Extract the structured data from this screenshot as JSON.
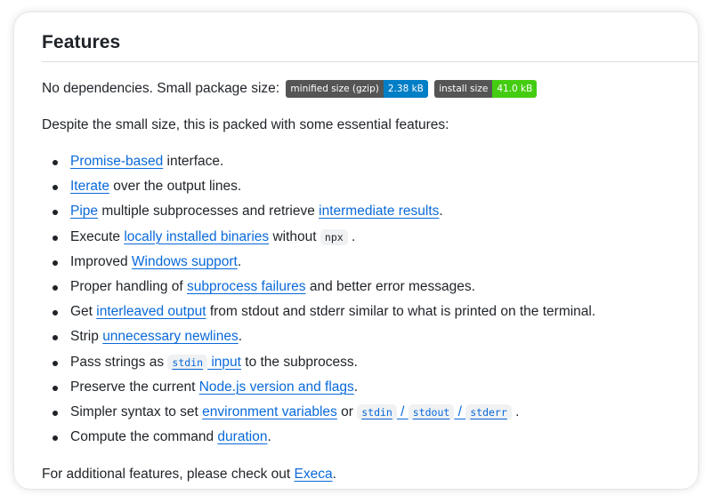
{
  "heading": "Features",
  "intro": {
    "text": "No dependencies. Small package size:",
    "badges": [
      {
        "label": "minified size (gzip)",
        "value": "2.38 kB",
        "color": "#007ec6"
      },
      {
        "label": "install size",
        "value": "41.0 kB",
        "color": "#44cc11"
      }
    ]
  },
  "lead": "Despite the small size, this is packed with some essential features:",
  "features": [
    {
      "a1": "Promise-based",
      "t1": " interface."
    },
    {
      "a1": "Iterate",
      "t1": " over the output lines."
    },
    {
      "a1": "Pipe",
      "t1": " multiple subprocesses and retrieve ",
      "a2": "intermediate results",
      "t2": "."
    },
    {
      "t0": "Execute ",
      "a1": "locally installed binaries",
      "t1": " without ",
      "code": "npx",
      "t2": "."
    },
    {
      "t0": "Improved ",
      "a1": "Windows support",
      "t1": "."
    },
    {
      "t0": "Proper handling of ",
      "a1": "subprocess failures",
      "t1": " and better error messages."
    },
    {
      "t0": "Get ",
      "a1": "interleaved output",
      "t1": " from stdout and stderr similar to what is printed on the terminal."
    },
    {
      "t0": "Strip ",
      "a1": "unnecessary newlines",
      "t1": "."
    },
    {
      "t0": "Pass strings as ",
      "code": "stdin",
      "a1": " input",
      "t1": " to the subprocess."
    },
    {
      "t0": "Preserve the current ",
      "a1": "Node.js version and flags",
      "t1": "."
    },
    {
      "t0": "Simpler syntax to set ",
      "a1": "environment variables",
      "t1": " or ",
      "c1": "stdin",
      "s1": " / ",
      "c2": "stdout",
      "s2": " / ",
      "c3": "stderr",
      "t2": "."
    },
    {
      "t0": "Compute the command ",
      "a1": "duration",
      "t1": "."
    }
  ],
  "outro": {
    "text": "For additional features, please check out ",
    "link": "Execa",
    "end": "."
  }
}
